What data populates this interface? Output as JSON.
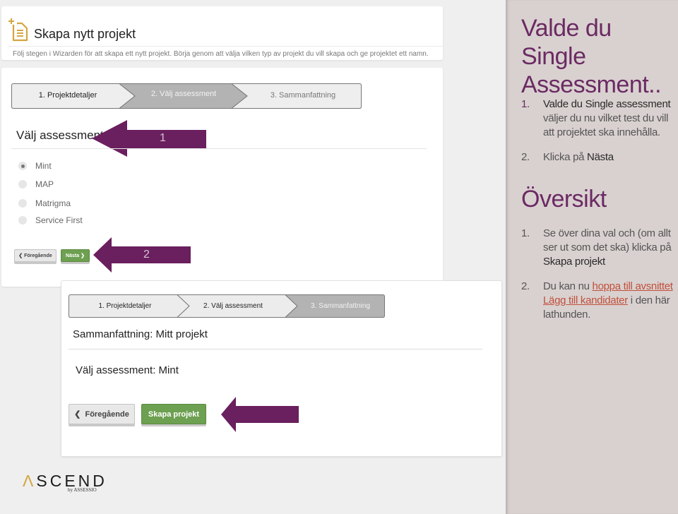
{
  "header": {
    "icon": "new-document-icon",
    "title": "Skapa nytt projekt",
    "description": "Följ stegen i Wizarden för att skapa ett nytt projekt. Börja genom att välja vilken typ av projekt du vill skapa och ge projektet ett namn."
  },
  "step2_panel": {
    "wizard_steps": [
      {
        "label": "1. Projektdetaljer",
        "state": "done"
      },
      {
        "label": "2. Välj assessment",
        "state": "active"
      },
      {
        "label": "3. Sammanfattning",
        "state": "pending"
      }
    ],
    "section_title": "Välj assessment",
    "options": [
      {
        "label": "Mint",
        "selected": true
      },
      {
        "label": "MAP",
        "selected": false
      },
      {
        "label": "Matrigma",
        "selected": false
      },
      {
        "label": "Service First",
        "selected": false
      }
    ],
    "prev_button": "Föregående",
    "next_button": "Nästa",
    "annotations": [
      "1",
      "2"
    ]
  },
  "step3_panel": {
    "wizard_steps": [
      {
        "label": "1. Projektdetaljer",
        "state": "done"
      },
      {
        "label": "2. Välj assessment",
        "state": "done"
      },
      {
        "label": "3. Sammanfattning",
        "state": "active"
      }
    ],
    "summary_title": "Sammanfattning: Mitt projekt",
    "summary_item": "Välj assessment: Mint",
    "prev_button": "Föregående",
    "create_button": "Skapa projekt"
  },
  "logo": {
    "name": "SCEND",
    "caret": "Λ",
    "sub": "by ASSESSIO"
  },
  "instructions": {
    "section1": {
      "heading": "Valde du Single Assessment..",
      "items": [
        {
          "num": "1.",
          "strong": "Valde du Single assessment",
          "text": " väljer du nu vilket test du vill att projektet ska innehålla."
        },
        {
          "num": "2.",
          "text": "Klicka på ",
          "strong": "Nästa"
        }
      ]
    },
    "section2": {
      "heading": "Översikt",
      "items": [
        {
          "num": "1.",
          "text": "Se över dina val och (om allt ser ut som det ska) klicka på ",
          "strong": "Skapa projekt"
        },
        {
          "num": "2.",
          "text": "Du kan nu ",
          "link": "hoppa till avsnittet Lägg till kandidater",
          "text_after": " i den här lathunden."
        }
      ]
    }
  },
  "colors": {
    "accent_purple": "#6b2a63",
    "arrow_purple": "#6a1f5e",
    "button_green": "#6da050",
    "link_red": "#c0503a",
    "panel_bg": "#d9d1d0",
    "icon_gold": "#d4a640"
  }
}
